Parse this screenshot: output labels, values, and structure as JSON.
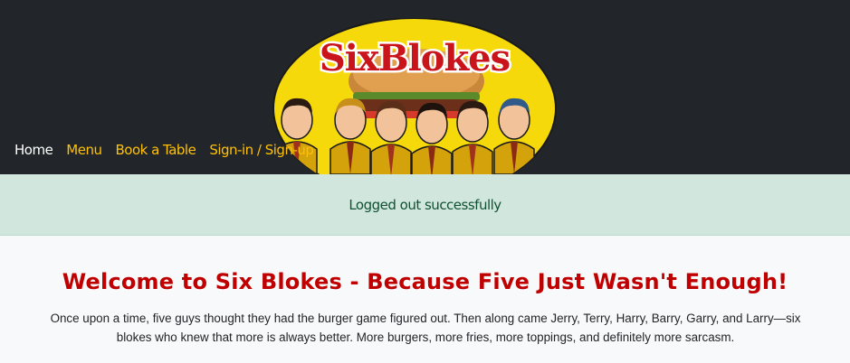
{
  "nav": {
    "items": [
      {
        "label": "Home",
        "active": true
      },
      {
        "label": "Menu",
        "active": false
      },
      {
        "label": "Book a Table",
        "active": false
      },
      {
        "label": "Sign-in / Sign-up",
        "active": false
      }
    ]
  },
  "logo": {
    "text": "SixBlokes"
  },
  "alert": {
    "message": "Logged out successfully"
  },
  "main": {
    "title": "Welcome to Six Blokes - Because Five Just Wasn't Enough!",
    "story": "Once upon a time, five guys thought they had the burger game figured out. Then along came Jerry, Terry, Harry, Barry, Garry, and Larry—six blokes who knew that more is always better. More burgers, more fries, more toppings, and definitely more sarcasm."
  },
  "colors": {
    "header_bg": "#22262a",
    "nav_accent": "#ffc107",
    "alert_bg": "#d1e7dd",
    "alert_text": "#0f5132",
    "title_red": "#c00000"
  }
}
